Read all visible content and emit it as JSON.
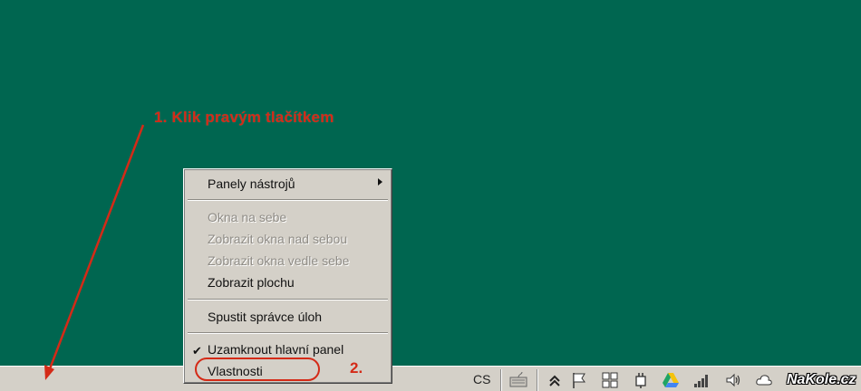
{
  "annotations": {
    "step1": "1. Klik pravým tlačítkem",
    "step2": "2."
  },
  "context_menu": {
    "items": [
      {
        "label": "Panely nástrojů",
        "enabled": true,
        "submenu": true
      },
      {
        "label": "Okna na sebe",
        "enabled": false
      },
      {
        "label": "Zobrazit okna nad sebou",
        "enabled": false
      },
      {
        "label": "Zobrazit okna vedle sebe",
        "enabled": false
      },
      {
        "label": "Zobrazit plochu",
        "enabled": true
      },
      {
        "label": "Spustit správce úloh",
        "enabled": true
      },
      {
        "label": "Uzamknout hlavní panel",
        "enabled": true,
        "checked": true
      },
      {
        "label": "Vlastnosti",
        "enabled": true,
        "highlighted": true
      }
    ]
  },
  "taskbar": {
    "language": "CS",
    "tray_icons": [
      "keyboard-icon",
      "chevron-up-icon",
      "flag-icon",
      "windows-icon",
      "power-plug-icon",
      "google-drive-icon",
      "signal-icon",
      "volume-icon",
      "cloud-icon"
    ]
  },
  "watermark": "NaKole.cz",
  "colors": {
    "desktop": "#006650",
    "annotation_red": "#d42a17",
    "menu_bg": "#d4d0c8"
  }
}
